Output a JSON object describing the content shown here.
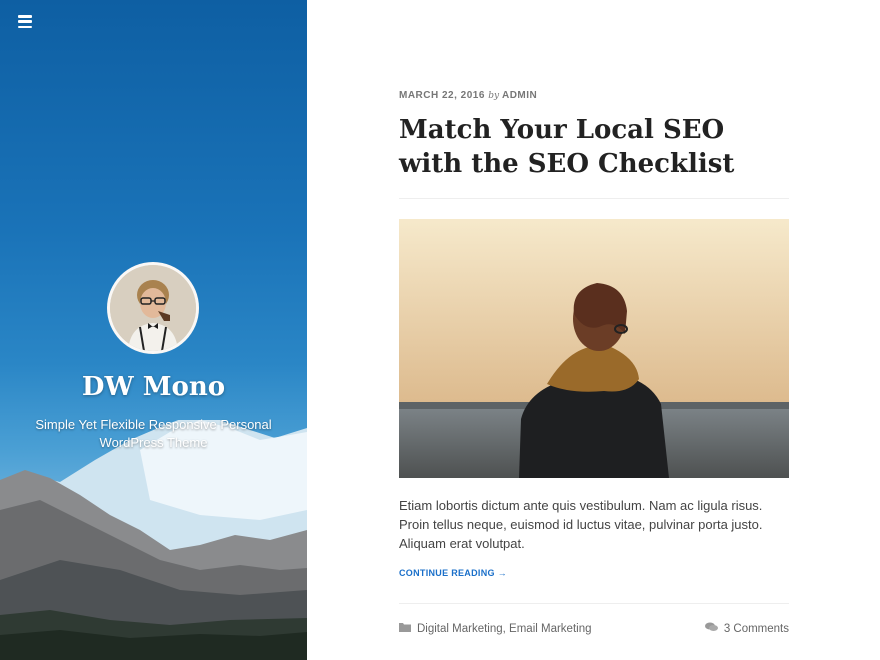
{
  "sidebar": {
    "site_title": "DW Mono",
    "site_description": "Simple Yet Flexible Responsive Personal WordPress Theme",
    "menu_icon": "hamburger-menu-icon"
  },
  "post": {
    "date": "MARCH 22, 2016",
    "by": "by",
    "author": "ADMIN",
    "title": "Match Your Local SEO with the SEO Checklist",
    "excerpt": "Etiam lobortis dictum ante quis vestibulum. Nam ac ligula risus. Proin tellus neque, euismod id luctus vitae, pulvinar porta justo. Aliquam erat volutpat.",
    "read_more": "CONTINUE READING →",
    "categories": [
      "Digital Marketing",
      "Email Marketing"
    ],
    "category_separator": ", ",
    "comments": "3 Comments"
  },
  "icons": {
    "category": "folder-icon",
    "comments": "comments-icon"
  },
  "colors": {
    "sidebar_blue": "#1a73b8",
    "link_blue": "#1a6fc9",
    "title_dark": "#222222",
    "meta_gray": "#777777"
  }
}
